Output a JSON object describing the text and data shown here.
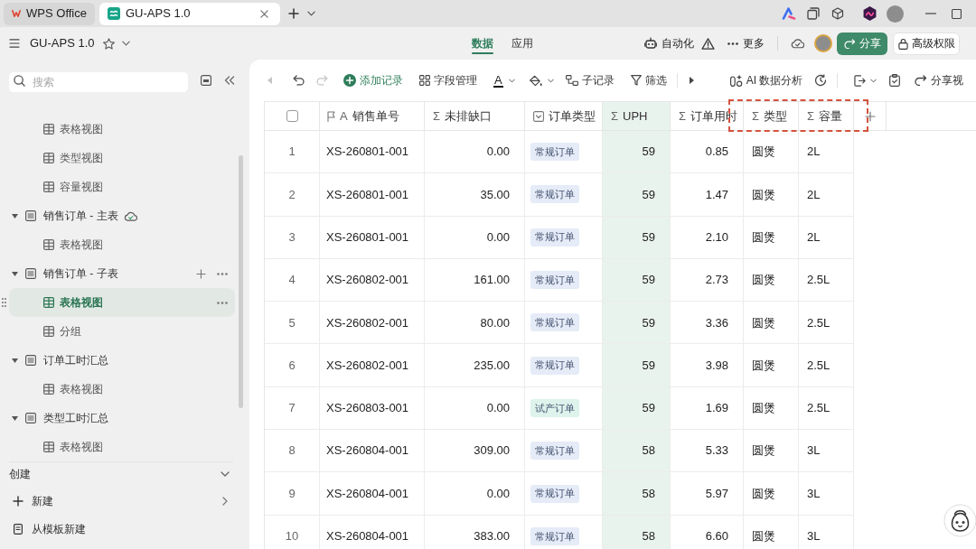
{
  "browser_tabs": [
    {
      "kind": "wps",
      "label": "WPS Office",
      "selected": false
    },
    {
      "kind": "app",
      "label": "GU-APS 1.0",
      "selected": true
    }
  ],
  "app_bar": {
    "title": "GU-APS 1.0",
    "view_tabs": [
      {
        "label": "数据",
        "selected": true
      },
      {
        "label": "应用",
        "selected": false
      }
    ],
    "actions": [
      {
        "kind": "automation",
        "label": "自动化",
        "warning": true
      },
      {
        "kind": "more",
        "label": "更多",
        "warning": false
      }
    ],
    "share_button": "分享",
    "permissions_button": "高级权限"
  },
  "sidebar": {
    "search": {
      "placeholder": "搜索"
    },
    "tree": [
      {
        "children": [
          {
            "label": "表格视图",
            "selected": false
          },
          {
            "label": "类型视图",
            "selected": false
          },
          {
            "label": "容量视图",
            "selected": false
          }
        ]
      },
      {
        "label": "销售订单 - 主表",
        "expanded": true,
        "synced": true,
        "hovered": false,
        "children": [
          {
            "label": "表格视图",
            "selected": false
          }
        ]
      },
      {
        "label": "销售订单 - 子表",
        "expanded": true,
        "synced": false,
        "hovered": true,
        "children": [
          {
            "label": "表格视图",
            "selected": true
          },
          {
            "label": "分组",
            "selected": false
          }
        ]
      },
      {
        "label": "订单工时汇总",
        "expanded": true,
        "synced": false,
        "hovered": false,
        "children": [
          {
            "label": "表格视图",
            "selected": false
          }
        ]
      },
      {
        "label": "类型工时汇总",
        "expanded": true,
        "synced": false,
        "hovered": false,
        "children": [
          {
            "label": "表格视图",
            "selected": false
          }
        ]
      }
    ],
    "create": {
      "label": "创建",
      "items": [
        {
          "kind": "new",
          "label": "新建"
        },
        {
          "kind": "template",
          "label": "从模板新建"
        }
      ]
    }
  },
  "toolbar": {
    "items": [
      {
        "kind": "back",
        "disabled": true
      },
      {
        "kind": "undo",
        "disabled": false
      },
      {
        "kind": "redo",
        "disabled": true
      },
      {
        "kind": "add",
        "label": "添加记录",
        "disabled": false
      },
      {
        "kind": "fields",
        "label": "字段管理",
        "disabled": false
      },
      {
        "kind": "text_color",
        "icon": "A",
        "disabled": false
      },
      {
        "kind": "fill_color",
        "disabled": false
      },
      {
        "kind": "subrecord",
        "label": "子记录",
        "disabled": false
      },
      {
        "kind": "filter",
        "label": "筛选",
        "disabled": false
      },
      {
        "kind": "expand",
        "disabled": false
      },
      {
        "kind": "ai",
        "label": "AI 数据分析",
        "disabled": false
      },
      {
        "kind": "history",
        "disabled": false
      },
      {
        "kind": "export",
        "disabled": false
      },
      {
        "kind": "clipboard",
        "disabled": false
      },
      {
        "kind": "share_view",
        "label": "分享视",
        "disabled": false
      }
    ]
  },
  "table": {
    "select_all_checked": false,
    "columns": [
      {
        "kind": "checkbox",
        "selected": false,
        "highlighted": false
      },
      {
        "kind": "primary",
        "icon": "A",
        "label": "销售单号",
        "selected": false,
        "highlighted": false
      },
      {
        "kind": "number",
        "icon": "Σ",
        "label": "未排缺口",
        "selected": false,
        "highlighted": false
      },
      {
        "kind": "select",
        "label": "订单类型",
        "selected": false,
        "highlighted": false
      },
      {
        "kind": "number",
        "icon": "Σ",
        "label": "UPH",
        "selected": true,
        "highlighted": false
      },
      {
        "kind": "number",
        "icon": "Σ",
        "label": "订单用时",
        "selected": false,
        "highlighted": false
      },
      {
        "kind": "text",
        "icon": "Σ",
        "label": "类型",
        "selected": false,
        "highlighted": true
      },
      {
        "kind": "text",
        "icon": "Σ",
        "label": "容量",
        "selected": false,
        "highlighted": true
      }
    ],
    "rows": [
      {
        "color": "#e5ebf7",
        "cells": [
          "1",
          "XS-260801-001",
          "0.00",
          "常规订单",
          "59",
          "0.85",
          "圆煲",
          "2L"
        ]
      },
      {
        "color": "#e5ebf7",
        "cells": [
          "2",
          "XS-260801-001",
          "35.00",
          "常规订单",
          "59",
          "1.47",
          "圆煲",
          "2L"
        ]
      },
      {
        "color": "#e5ebf7",
        "cells": [
          "3",
          "XS-260801-001",
          "0.00",
          "常规订单",
          "59",
          "2.10",
          "圆煲",
          "2L"
        ]
      },
      {
        "color": "#e5ebf7",
        "cells": [
          "4",
          "XS-260802-001",
          "161.00",
          "常规订单",
          "59",
          "2.73",
          "圆煲",
          "2.5L"
        ]
      },
      {
        "color": "#e5ebf7",
        "cells": [
          "5",
          "XS-260802-001",
          "80.00",
          "常规订单",
          "59",
          "3.36",
          "圆煲",
          "2.5L"
        ]
      },
      {
        "color": "#e5ebf7",
        "cells": [
          "6",
          "XS-260802-001",
          "235.00",
          "常规订单",
          "59",
          "3.98",
          "圆煲",
          "2.5L"
        ]
      },
      {
        "color": "#ddf3ec",
        "cells": [
          "7",
          "XS-260803-001",
          "0.00",
          "试产订单",
          "59",
          "1.69",
          "圆煲",
          "2.5L"
        ]
      },
      {
        "color": "#e5ebf7",
        "cells": [
          "8",
          "XS-260804-001",
          "309.00",
          "常规订单",
          "58",
          "5.33",
          "圆煲",
          "3L"
        ]
      },
      {
        "color": "#e5ebf7",
        "cells": [
          "9",
          "XS-260804-001",
          "0.00",
          "常规订单",
          "58",
          "5.97",
          "圆煲",
          "3L"
        ]
      },
      {
        "color": "#e5ebf7",
        "cells": [
          "10",
          "XS-260804-001",
          "383.00",
          "常规订单",
          "58",
          "6.60",
          "圆煲",
          "3L"
        ]
      }
    ]
  }
}
